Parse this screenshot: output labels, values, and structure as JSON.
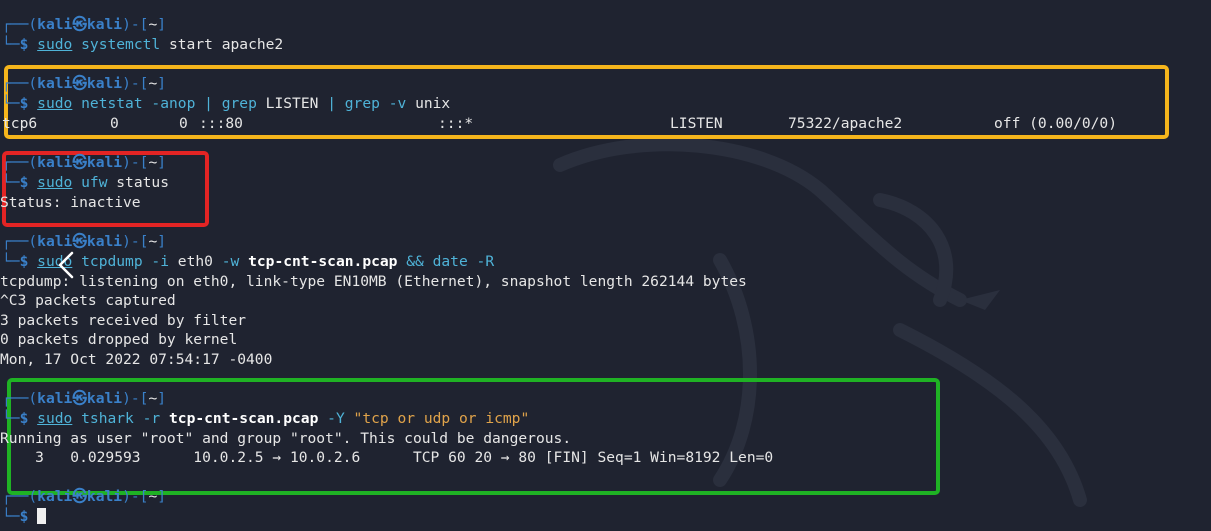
{
  "prompt": {
    "corner_top": "┌──(",
    "user": "kali",
    "at": "㉿",
    "host": "kali",
    "close": ")-[",
    "dir": "~",
    "end": "]",
    "corner_bottom": "└─",
    "dollar": "$"
  },
  "blocks": {
    "b1": {
      "cmd_sudo": "sudo",
      "cmd_rest": "systemctl",
      "args": " start apache2"
    },
    "b2": {
      "cmd_sudo": "sudo",
      "cmd_rest": "netstat",
      "flag": " -anop ",
      "pipe1": "|",
      "grep1": " grep",
      "arg1": " LISTEN ",
      "pipe2": "|",
      "grep2": " grep",
      "flag2": " -v",
      "arg2": " unix",
      "out": {
        "proto": "tcp6",
        "recvq": "0",
        "sendq": "0",
        "local": ":::80",
        "foreign": ":::*",
        "state": "LISTEN",
        "pid": "75322/apache2",
        "timer": "off (0.00/0/0)"
      }
    },
    "b3": {
      "cmd_sudo": "sudo",
      "cmd_rest": "ufw",
      "args": " status",
      "out": "Status: inactive"
    },
    "b4": {
      "cmd_sudo": "sudo",
      "cmd_rest": "tcpdump",
      "flag": " -i",
      "arg1": " eth0",
      "flag2": " -w ",
      "file": "tcp-cnt-scan.pcap",
      "and": " &&",
      "date": " date",
      "flag3": " -R",
      "out": [
        "tcpdump: listening on eth0, link-type EN10MB (Ethernet), snapshot length 262144 bytes",
        "^C3 packets captured",
        "3 packets received by filter",
        "0 packets dropped by kernel",
        "Mon, 17 Oct 2022 07:54:17 -0400"
      ]
    },
    "b5": {
      "cmd_sudo": "sudo",
      "cmd_rest": "tshark",
      "flag": " -r ",
      "file": "tcp-cnt-scan.pcap",
      "flag2": " -Y ",
      "filter": "\"tcp or udp or icmp\"",
      "out1": "Running as user \"root\" and group \"root\". This could be dangerous.",
      "out2": "    3   0.029593      10.0.2.5 → 10.0.2.6      TCP 60 20 → 80 [FIN] Seq=1 Win=8192 Len=0"
    }
  },
  "colors": {
    "background": "#1f2330",
    "prompt_blue": "#3a80c9",
    "command_cyan": "#4fb3d8",
    "string_orange": "#e0a34a",
    "highlight_yellow": "#f5b51c",
    "highlight_red": "#e32424",
    "highlight_green": "#1fb224"
  },
  "icons": {
    "nav_arrow": "chevron-left-icon",
    "background_logo": "kali-dragon-watermark"
  }
}
